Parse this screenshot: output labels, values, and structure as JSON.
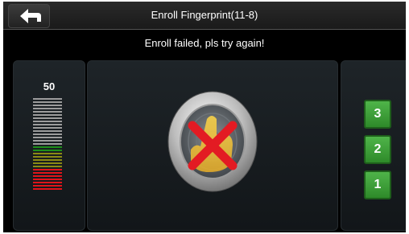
{
  "header": {
    "title": "Enroll Fingerprint(11-8)"
  },
  "status": {
    "message": "Enroll failed, pls try again!"
  },
  "quality": {
    "value": "50"
  },
  "steps": [
    "3",
    "2",
    "1"
  ],
  "colors": {
    "meter_gray": "#9c9c9c",
    "meter_green": "#1e8f1a",
    "meter_olive": "#8b8a14",
    "meter_red": "#e0141a",
    "step_green": "#3ea638"
  },
  "icons": {
    "back": "back-arrow-icon",
    "sensor": "fingerprint-sensor-icon",
    "fail": "red-x-icon"
  }
}
